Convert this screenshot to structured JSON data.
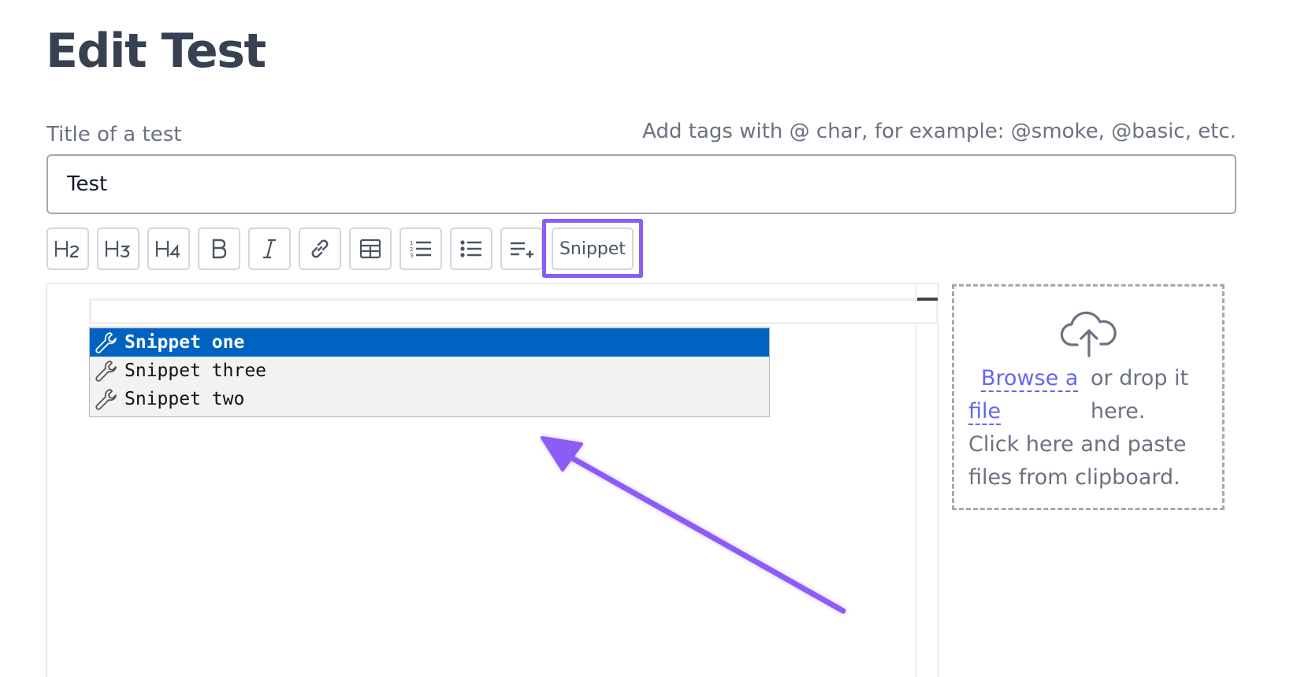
{
  "page": {
    "title": "Edit Test"
  },
  "title_field": {
    "label": "Title of a test",
    "hint": "Add tags with @ char, for example: @smoke, @basic, etc.",
    "value": "Test"
  },
  "toolbar": {
    "buttons": [
      {
        "name": "h2",
        "icon": "heading-2-icon"
      },
      {
        "name": "h3",
        "icon": "heading-3-icon"
      },
      {
        "name": "h4",
        "icon": "heading-4-icon"
      },
      {
        "name": "bold",
        "icon": "bold-icon"
      },
      {
        "name": "italic",
        "icon": "italic-icon"
      },
      {
        "name": "link",
        "icon": "link-icon"
      },
      {
        "name": "table",
        "icon": "table-icon"
      },
      {
        "name": "ordered-list",
        "icon": "ordered-list-icon"
      },
      {
        "name": "unordered-list",
        "icon": "unordered-list-icon"
      },
      {
        "name": "insert-step",
        "icon": "list-add-icon"
      }
    ],
    "snippet_label": "Snippet"
  },
  "autocomplete": {
    "items": [
      {
        "label": "Snippet one",
        "icon": "wrench-icon",
        "selected": true
      },
      {
        "label": "Snippet three",
        "icon": "wrench-icon",
        "selected": false
      },
      {
        "label": "Snippet two",
        "icon": "wrench-icon",
        "selected": false
      }
    ]
  },
  "dropzone": {
    "icon": "cloud-upload-icon",
    "browse_line1": "Browse a",
    "browse_line2": "file",
    "drop_line1": "or drop it",
    "drop_line2": "here.",
    "paste_line1": "Click here and paste",
    "paste_line2": "files from clipboard."
  },
  "colors": {
    "highlight": "#8b5cf6",
    "selection": "#0063c1",
    "link": "#6366f1"
  }
}
